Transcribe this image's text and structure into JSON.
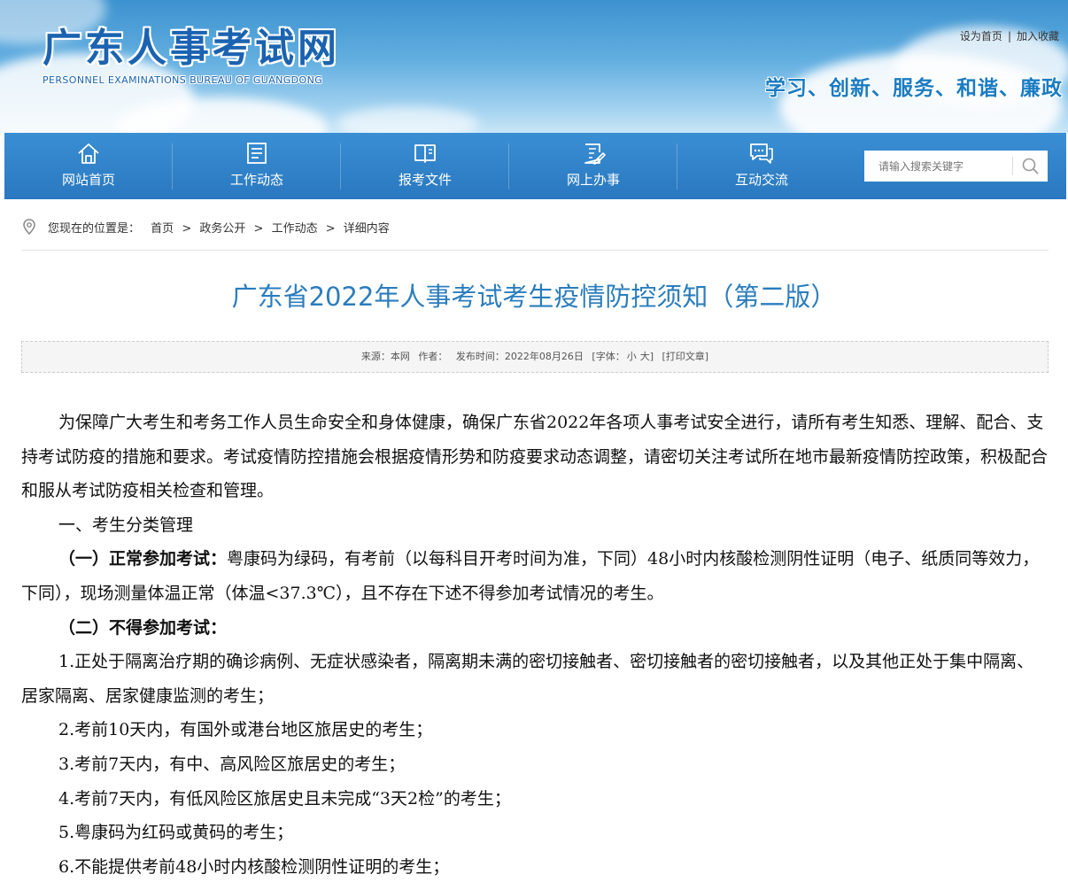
{
  "header": {
    "logo_cn": "广东人事考试网",
    "logo_en": "PERSONNEL EXAMINATIONS BUREAU OF GUANGDONG",
    "set_home": "设为首页",
    "separator": "|",
    "add_fav": "加入收藏",
    "slogan": "学习、创新、服务、和谐、廉政"
  },
  "nav": {
    "items": [
      {
        "label": "网站首页",
        "icon": "home-icon"
      },
      {
        "label": "工作动态",
        "icon": "news-list-icon"
      },
      {
        "label": "报考文件",
        "icon": "book-icon"
      },
      {
        "label": "网上办事",
        "icon": "edit-document-icon"
      },
      {
        "label": "互动交流",
        "icon": "chat-icon"
      }
    ],
    "search_placeholder": "请输入搜索关键字"
  },
  "breadcrumb": {
    "prefix": "您现在的位置是：",
    "items": [
      "首页",
      "政务公开",
      "工作动态",
      "详细内容"
    ],
    "sep": ">"
  },
  "article": {
    "title": "广东省2022年人事考试考生疫情防控须知（第二版）",
    "meta": {
      "source": "来源：本网",
      "author": "作者：",
      "date": "发布时间：2022年08月26日",
      "font_open": "[字体：",
      "font_small": "小",
      "font_big": "大",
      "font_close": "]",
      "print": "[打印文章]"
    },
    "para1": "为保障广大考生和考务工作人员生命安全和身体健康，确保广东省2022年各项人事考试安全进行，请所有考生知悉、理解、配合、支持考试防疫的措施和要求。考试疫情防控措施会根据疫情形势和防疫要求动态调整，请密切关注考试所在地市最新疫情防控政策，积极配合和服从考试防疫相关检查和管理。",
    "section1": "一、考生分类管理",
    "normal_label": "（一）正常参加考试：",
    "normal_text": "粤康码为绿码，有考前（以每科目开考时间为准，下同）48小时内核酸检测阴性证明（电子、纸质同等效力，下同），现场测量体温正常（体温<37.3℃），且不存在下述不得参加考试情况的考生。",
    "not_allowed_label": "（二）不得参加考试：",
    "items": [
      "1.正处于隔离治疗期的确诊病例、无症状感染者，隔离期未满的密切接触者、密切接触者的密切接触者，以及其他正处于集中隔离、居家隔离、居家健康监测的考生；",
      "2.考前10天内，有国外或港台地区旅居史的考生；",
      "3.考前7天内，有中、高风险区旅居史的考生；",
      "4.考前7天内，有低风险区旅居史且未完成“3天2检”的考生；",
      "5.粤康码为红码或黄码的考生；",
      "6.不能提供考前48小时内核酸检测阴性证明的考生；"
    ]
  },
  "colors": {
    "nav_bg": "#2a80c8",
    "title": "#2b7dbd",
    "logo": "#1b63b0"
  }
}
